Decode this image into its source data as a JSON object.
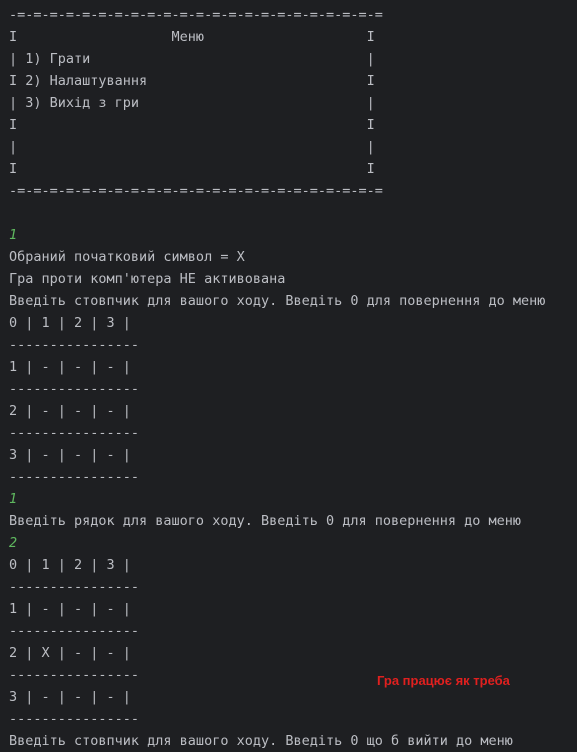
{
  "console": {
    "lines": [
      {
        "text": "-=-=-=-=-=-=-=-=-=-=-=-=-=-=-=-=-=-=-=-=-=-=-=",
        "kind": "output"
      },
      {
        "text": "I                   Меню                    I",
        "kind": "output"
      },
      {
        "text": "| 1) Грати                                  |",
        "kind": "output"
      },
      {
        "text": "I 2) Налаштування                           I",
        "kind": "output"
      },
      {
        "text": "| 3) Вихід з гри                            |",
        "kind": "output"
      },
      {
        "text": "I                                           I",
        "kind": "output"
      },
      {
        "text": "|                                           |",
        "kind": "output"
      },
      {
        "text": "I                                           I",
        "kind": "output"
      },
      {
        "text": "-=-=-=-=-=-=-=-=-=-=-=-=-=-=-=-=-=-=-=-=-=-=-=",
        "kind": "output"
      },
      {
        "text": "",
        "kind": "output"
      },
      {
        "text": "1",
        "kind": "input"
      },
      {
        "text": "Обраний початковий символ = X",
        "kind": "output"
      },
      {
        "text": "Гра проти комп'ютера НЕ активована",
        "kind": "output"
      },
      {
        "text": "Введіть стовпчик для вашого ходу. Введіть 0 для повернення до меню",
        "kind": "output"
      },
      {
        "text": "0 | 1 | 2 | 3 |",
        "kind": "output"
      },
      {
        "text": "----------------",
        "kind": "output"
      },
      {
        "text": "1 | - | - | - |",
        "kind": "output"
      },
      {
        "text": "----------------",
        "kind": "output"
      },
      {
        "text": "2 | - | - | - |",
        "kind": "output"
      },
      {
        "text": "----------------",
        "kind": "output"
      },
      {
        "text": "3 | - | - | - |",
        "kind": "output"
      },
      {
        "text": "----------------",
        "kind": "output"
      },
      {
        "text": "1",
        "kind": "input"
      },
      {
        "text": "Введіть рядок для вашого ходу. Введіть 0 для повернення до меню",
        "kind": "output"
      },
      {
        "text": "2",
        "kind": "input"
      },
      {
        "text": "0 | 1 | 2 | 3 |",
        "kind": "output"
      },
      {
        "text": "----------------",
        "kind": "output"
      },
      {
        "text": "1 | - | - | - |",
        "kind": "output"
      },
      {
        "text": "----------------",
        "kind": "output"
      },
      {
        "text": "2 | X | - | - |",
        "kind": "output"
      },
      {
        "text": "----------------",
        "kind": "output"
      },
      {
        "text": "3 | - | - | - |",
        "kind": "output"
      },
      {
        "text": "----------------",
        "kind": "output"
      },
      {
        "text": "Введіть стовпчик для вашого ходу. Введіть 0 що б вийти до меню",
        "kind": "output"
      }
    ],
    "annotation": "Гра працює як треба",
    "colors": {
      "background": "#1e1f22",
      "output_text": "#bcbec4",
      "input_text": "#5fb85f",
      "annotation_text": "#e0201f"
    }
  }
}
